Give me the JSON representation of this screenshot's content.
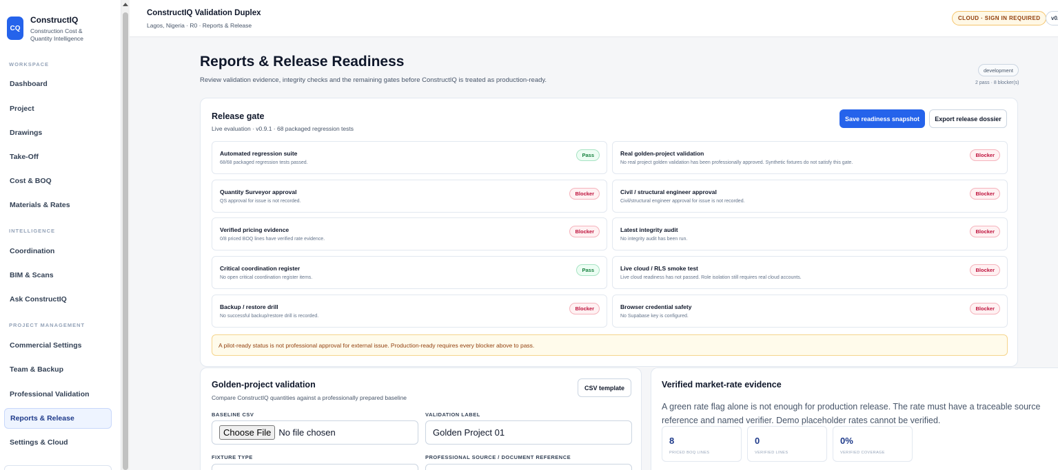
{
  "brand": {
    "logo": "CQ",
    "name": "ConstructIQ",
    "subtitle": "Construction Cost & Quantity Intelligence"
  },
  "sidebar": {
    "sections": [
      {
        "label": "WORKSPACE",
        "items": [
          "Dashboard",
          "Project",
          "Drawings",
          "Take-Off",
          "Cost & BOQ",
          "Materials & Rates"
        ]
      },
      {
        "label": "INTELLIGENCE",
        "items": [
          "Coordination",
          "BIM & Scans",
          "Ask ConstructIQ"
        ]
      },
      {
        "label": "PROJECT MANAGEMENT",
        "items": [
          "Commercial Settings",
          "Team & Backup",
          "Professional Validation",
          "Reports & Release",
          "Settings & Cloud"
        ]
      }
    ],
    "active": "Reports & Release"
  },
  "header": {
    "title": "ConstructIQ Validation Duplex",
    "breadcrumb": "Lagos, Nigeria · R0 · Reports & Release",
    "cloud_badge": "CLOUD · SIGN IN REQUIRED",
    "version_badge": "v0."
  },
  "page": {
    "title": "Reports & Release Readiness",
    "subtitle": "Review validation evidence, integrity checks and the remaining gates before ConstructIQ is treated as production-ready.",
    "env_badge": "development",
    "env_summary": "2 pass · 8 blocker(s)"
  },
  "release_gate": {
    "title": "Release gate",
    "subtitle": "Live evaluation · v0.9.1 · 68 packaged regression tests",
    "save_button": "Save readiness snapshot",
    "export_button": "Export release dossier",
    "gates": [
      {
        "name": "Automated regression suite",
        "desc": "68/68 packaged regression tests passed.",
        "status": "Pass"
      },
      {
        "name": "Real golden-project validation",
        "desc": "No real project golden validation has been professionally approved. Synthetic fixtures do not satisfy this gate.",
        "status": "Blocker"
      },
      {
        "name": "Quantity Surveyor approval",
        "desc": "QS approval for issue is not recorded.",
        "status": "Blocker"
      },
      {
        "name": "Civil / structural engineer approval",
        "desc": "Civil/structural engineer approval for issue is not recorded.",
        "status": "Blocker"
      },
      {
        "name": "Verified pricing evidence",
        "desc": "0/8 priced BOQ lines have verified rate evidence.",
        "status": "Blocker"
      },
      {
        "name": "Latest integrity audit",
        "desc": "No integrity audit has been run.",
        "status": "Blocker"
      },
      {
        "name": "Critical coordination register",
        "desc": "No open critical coordination register items.",
        "status": "Pass"
      },
      {
        "name": "Live cloud / RLS smoke test",
        "desc": "Live cloud readiness has not passed. Role isolation still requires real cloud accounts.",
        "status": "Blocker"
      },
      {
        "name": "Backup / restore drill",
        "desc": "No successful backup/restore drill is recorded.",
        "status": "Blocker"
      },
      {
        "name": "Browser credential safety",
        "desc": "No Supabase key is configured.",
        "status": "Blocker"
      }
    ],
    "notice": "A pilot-ready status is not professional approval for external issue. Production-ready requires every blocker above to pass."
  },
  "golden": {
    "title": "Golden-project validation",
    "subtitle": "Compare ConstructIQ quantities against a professionally prepared baseline",
    "csv_button": "CSV template",
    "baseline_label": "BASELINE CSV",
    "file_button": "Choose File",
    "file_status": "No file chosen",
    "validation_label": "VALIDATION LABEL",
    "validation_value": "Golden Project 01",
    "fixture_label": "FIXTURE TYPE",
    "source_label": "PROFESSIONAL SOURCE / DOCUMENT REFERENCE"
  },
  "rates": {
    "title": "Verified market-rate evidence",
    "text": "A green rate flag alone is not enough for production release. The rate must have a traceable source reference and named verifier. Demo placeholder rates cannot be verified.",
    "stats": [
      {
        "value": "8",
        "label": "PRICED BOQ LINES"
      },
      {
        "value": "0",
        "label": "VERIFIED LINES"
      },
      {
        "value": "0%",
        "label": "VERIFIED COVERAGE"
      }
    ]
  }
}
